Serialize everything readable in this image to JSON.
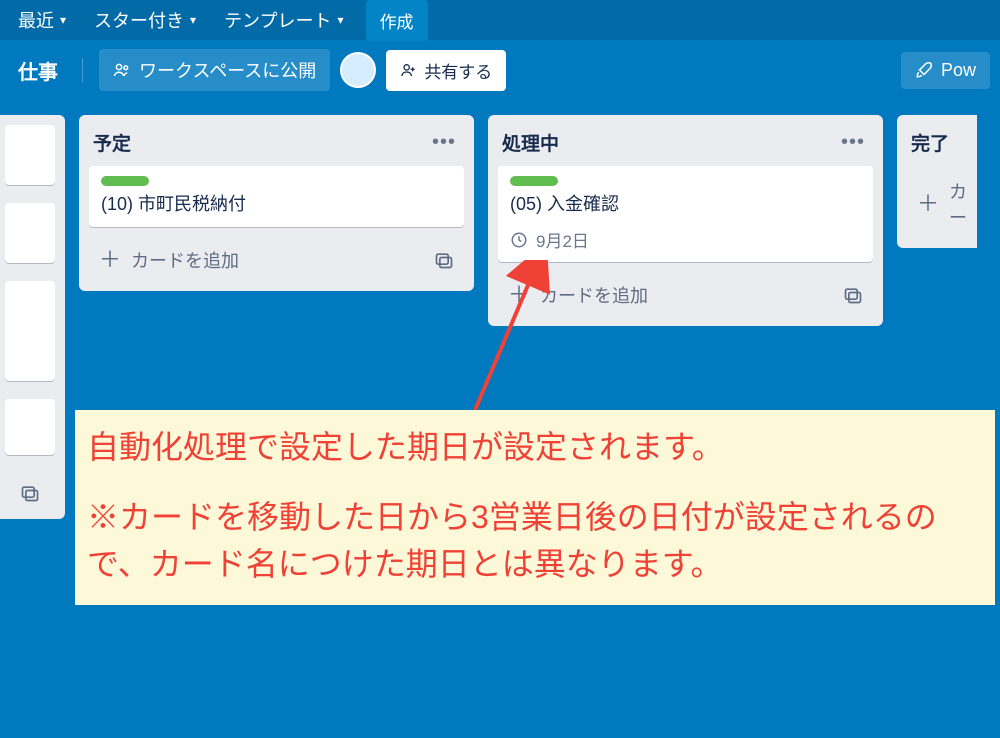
{
  "nav": {
    "recent": "最近",
    "starred": "スター付き",
    "templates": "テンプレート",
    "create": "作成"
  },
  "board_header": {
    "board_name": "仕事",
    "visibility": "ワークスペースに公開",
    "share": "共有する",
    "powerup": "Pow"
  },
  "lists": {
    "scheduled": {
      "title": "予定",
      "card1": "(10) 市町民税納付",
      "add": "カードを追加"
    },
    "processing": {
      "title": "処理中",
      "card1": "(05) 入金確認",
      "due": "9月2日",
      "add": "カードを追加"
    },
    "done": {
      "title": "完了",
      "add": "カー"
    }
  },
  "annotation": {
    "line1": "自動化処理で設定した期日が設定されます。",
    "line2": "※カードを移動した日から3営業日後の日付が設定されるので、カード名につけた期日とは異なります。"
  },
  "colors": {
    "board_bg": "#0079bf",
    "list_bg": "#ebecf0",
    "label_green": "#61bd4f",
    "annotation_bg": "#fdf8d8",
    "annotation_text": "#ef4136"
  }
}
